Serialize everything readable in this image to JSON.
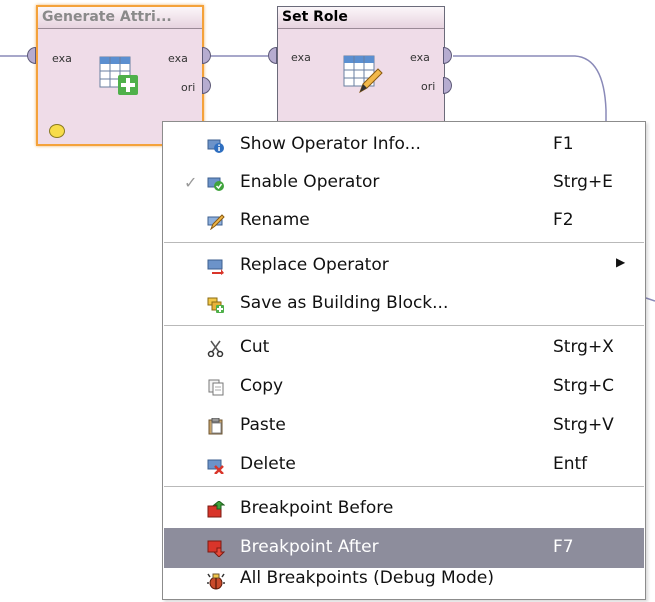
{
  "operators": [
    {
      "title": "Generate Attri...",
      "ports_in": [
        "exa"
      ],
      "ports_out": [
        "exa",
        "ori"
      ],
      "selected": true
    },
    {
      "title": "Set Role",
      "ports_in": [
        "exa"
      ],
      "ports_out": [
        "exa",
        "ori"
      ],
      "selected": false
    }
  ],
  "menu": {
    "items": [
      {
        "label": "Show Operator Info...",
        "shortcut": "F1",
        "icon": "info-icon"
      },
      {
        "label": "Enable Operator",
        "shortcut": "Strg+E",
        "icon": "enable-icon",
        "checked": true
      },
      {
        "label": "Rename",
        "shortcut": "F2",
        "icon": "rename-icon"
      },
      {
        "label": "Replace Operator",
        "shortcut": "",
        "icon": "replace-icon",
        "submenu": true
      },
      {
        "label": "Save as Building Block...",
        "shortcut": "",
        "icon": "building-block-icon"
      },
      {
        "label": "Cut",
        "shortcut": "Strg+X",
        "icon": "cut-icon"
      },
      {
        "label": "Copy",
        "shortcut": "Strg+C",
        "icon": "copy-icon"
      },
      {
        "label": "Paste",
        "shortcut": "Strg+V",
        "icon": "paste-icon"
      },
      {
        "label": "Delete",
        "shortcut": "Entf",
        "icon": "delete-icon"
      },
      {
        "label": "Breakpoint Before",
        "shortcut": "",
        "icon": "breakpoint-before-icon"
      },
      {
        "label": "Breakpoint After",
        "shortcut": "F7",
        "icon": "breakpoint-after-icon",
        "highlighted": true
      },
      {
        "label": "All Breakpoints (Debug Mode)",
        "shortcut": "",
        "icon": "all-breakpoints-icon"
      }
    ]
  },
  "colors": {
    "operator_bg": "#efdce8",
    "selection": "#f4a23a",
    "connection": "#8a8ab8",
    "highlight": "#8d8d9c"
  }
}
